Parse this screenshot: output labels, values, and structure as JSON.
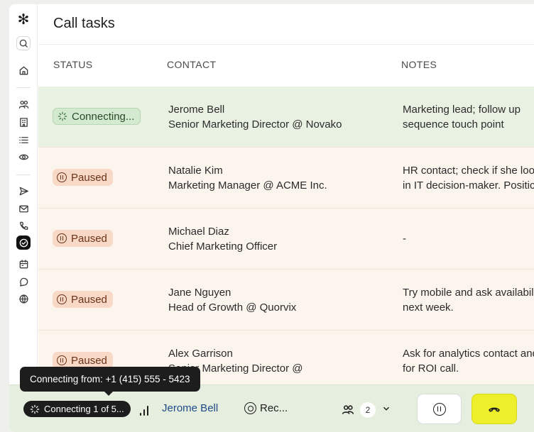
{
  "page_title": "Call tasks",
  "columns": {
    "status": "STATUS",
    "contact": "CONTACT",
    "notes": "NOTES"
  },
  "rows": [
    {
      "status": "Connecting...",
      "name": "Jerome Bell",
      "title": "Senior Marketing Director @ Novako",
      "notes_1": "Marketing lead; follow up",
      "notes_2": "sequence touch point"
    },
    {
      "status": "Paused",
      "name": "Natalie Kim",
      "title": "Marketing Manager @ ACME Inc.",
      "notes_1": "HR contact; check if she loo",
      "notes_2": "in IT decision-maker. Positic"
    },
    {
      "status": "Paused",
      "name": "Michael Diaz",
      "title": "Chief Marketing Officer",
      "notes_1": "-",
      "notes_2": ""
    },
    {
      "status": "Paused",
      "name": "Jane Nguyen",
      "title": "Head of Growth @ Quorvix",
      "notes_1": "Try mobile and ask availabilit",
      "notes_2": "next week."
    },
    {
      "status": "Paused",
      "name": "Alex Garrison",
      "title": "Senior Marketing Director @",
      "notes_1": "Ask for analytics contact and",
      "notes_2": "for ROI call."
    }
  ],
  "tooltip": "Connecting from: +1 (415) 555 - 5423",
  "callbar": {
    "progress_label": "Connecting 1 of 5...",
    "caller_name": "Jerome Bell",
    "record_label": "Rec...",
    "participants_count": "2"
  },
  "colors": {
    "active_row": "#e9f1e3",
    "paused_pill": "#f8d8c6",
    "hangup_button": "#ecef2a",
    "callbar_bg": "#e6efdf"
  },
  "sidebar_icons": [
    "logo-icon",
    "search-icon",
    "home-icon",
    "contacts-icon",
    "building-icon",
    "list-icon",
    "eye-icon",
    "send-icon",
    "mail-icon",
    "phone-icon",
    "tasks-check-icon",
    "calendar-icon",
    "chat-icon",
    "globe-icon"
  ]
}
